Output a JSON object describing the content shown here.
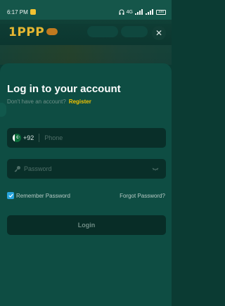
{
  "status_bar": {
    "time": "6:17 PM",
    "network_text": "4G",
    "battery": "100"
  },
  "header": {
    "logo_text": "1PPP",
    "close_icon": "close-icon"
  },
  "login": {
    "title": "Log in to your account",
    "no_account_text": "Don't have an account?",
    "register_link": "Register",
    "phone": {
      "country_flag": "pakistan-flag-icon",
      "dial_code": "+92",
      "placeholder": "Phone",
      "value": ""
    },
    "password": {
      "placeholder": "Password",
      "value": ""
    },
    "remember_label": "Remember Password",
    "remember_checked": true,
    "forgot_link": "Forgot Password?",
    "login_button": "Login"
  },
  "colors": {
    "accent": "#f2c200",
    "sheet": "#0e4d43",
    "field": "#092f29",
    "checkbox": "#27a4dc"
  }
}
